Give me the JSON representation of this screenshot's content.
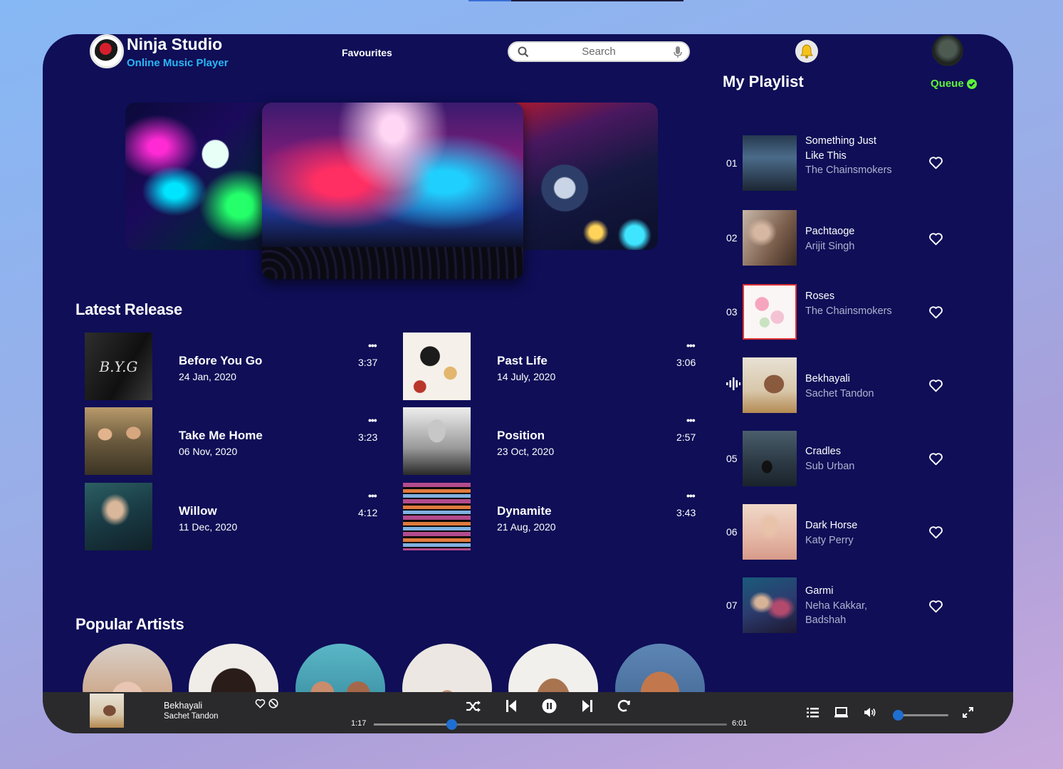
{
  "brand": {
    "title": "Ninja Studio",
    "subtitle": "Online Music Player"
  },
  "nav": {
    "favourites": "Favourites"
  },
  "search": {
    "placeholder": "Search"
  },
  "sections": {
    "latest": "Latest Release",
    "popular": "Popular Artists"
  },
  "latest": [
    {
      "title": "Before You Go",
      "date": "24 Jan, 2020",
      "duration": "3:37",
      "more": "•••"
    },
    {
      "title": "Past Life",
      "date": "14 July, 2020",
      "duration": "3:06",
      "more": "•••"
    },
    {
      "title": "Take Me Home",
      "date": "06 Nov, 2020",
      "duration": "3:23",
      "more": "•••"
    },
    {
      "title": "Position",
      "date": "23 Oct, 2020",
      "duration": "2:57",
      "more": "•••"
    },
    {
      "title": "Willow",
      "date": "11 Dec, 2020",
      "duration": "4:12",
      "more": "•••"
    },
    {
      "title": "Dynamite",
      "date": "21 Aug, 2020",
      "duration": "3:43",
      "more": "•••"
    }
  ],
  "playlist": {
    "title": "My Playlist",
    "queue": "Queue",
    "items": [
      {
        "num": "01",
        "name": "Something Just Like This",
        "artist": "The Chainsmokers"
      },
      {
        "num": "02",
        "name": "Pachtaoge",
        "artist": "Arijit Singh"
      },
      {
        "num": "03",
        "name": "Roses",
        "artist": "The Chainsmokers"
      },
      {
        "num": "",
        "name": "Bekhayali",
        "artist": "Sachet Tandon"
      },
      {
        "num": "05",
        "name": "Cradles",
        "artist": "Sub Urban"
      },
      {
        "num": "06",
        "name": "Dark Horse",
        "artist": "Katy Perry"
      },
      {
        "num": "07",
        "name": "Garmi",
        "artist": "Neha Kakkar, Badshah"
      }
    ]
  },
  "player": {
    "title": "Bekhayali",
    "artist": "Sachet Tandon",
    "current_time": "1:17",
    "total_time": "6:01",
    "progress": 0.22,
    "volume": 0.05
  },
  "colors": {
    "panel": "#0f0e57",
    "accent": "#29b6f6",
    "queue": "#5df23a",
    "knob": "#1f6fd2"
  }
}
